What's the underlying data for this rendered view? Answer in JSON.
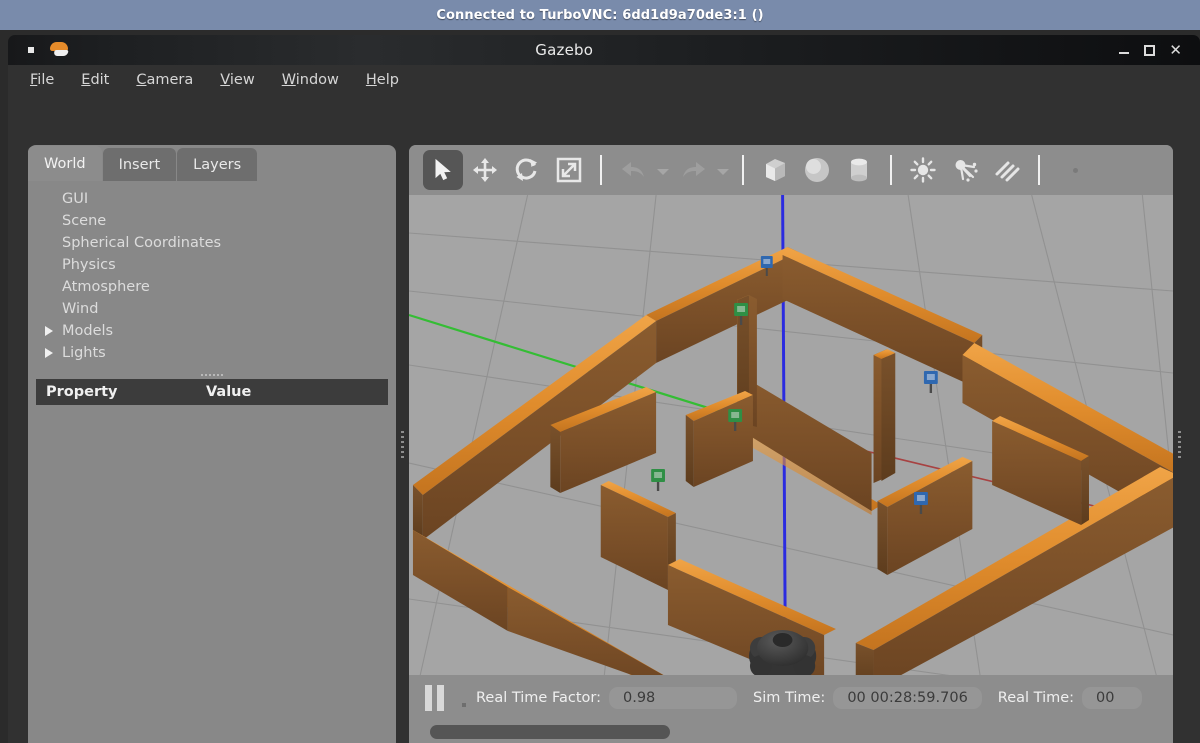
{
  "vnc": {
    "title": "Connected to TurboVNC: 6dd1d9a70de3:1 ()",
    "bar_color": "#798bab"
  },
  "window": {
    "title": "Gazebo",
    "logo_icon": "gazebo-logo-icon",
    "minimize_icon": "minimize-icon",
    "maximize_icon": "maximize-icon",
    "close_icon": "close-icon",
    "close_label": "✕"
  },
  "menubar": {
    "items": [
      {
        "label": "File",
        "mnemonic": "F"
      },
      {
        "label": "Edit",
        "mnemonic": "E"
      },
      {
        "label": "Camera",
        "mnemonic": "C"
      },
      {
        "label": "View",
        "mnemonic": "V"
      },
      {
        "label": "Window",
        "mnemonic": "W"
      },
      {
        "label": "Help",
        "mnemonic": "H"
      }
    ]
  },
  "left_panel": {
    "tabs": [
      {
        "label": "World",
        "active": true
      },
      {
        "label": "Insert",
        "active": false
      },
      {
        "label": "Layers",
        "active": false
      }
    ],
    "tree": [
      {
        "label": "GUI",
        "expandable": false
      },
      {
        "label": "Scene",
        "expandable": false
      },
      {
        "label": "Spherical Coordinates",
        "expandable": false
      },
      {
        "label": "Physics",
        "expandable": false
      },
      {
        "label": "Atmosphere",
        "expandable": false
      },
      {
        "label": "Wind",
        "expandable": false
      },
      {
        "label": "Models",
        "expandable": true
      },
      {
        "label": "Lights",
        "expandable": true
      }
    ],
    "property_table": {
      "columns": [
        "Property",
        "Value"
      ],
      "rows": []
    }
  },
  "toolbar": {
    "tools": [
      {
        "name": "select-tool",
        "icon": "cursor-arrow-icon",
        "active": true,
        "enabled": true
      },
      {
        "name": "translate-tool",
        "icon": "move-arrows-icon",
        "active": false,
        "enabled": true
      },
      {
        "name": "rotate-tool",
        "icon": "rotate-icon",
        "active": false,
        "enabled": true
      },
      {
        "name": "scale-tool",
        "icon": "scale-icon",
        "active": false,
        "enabled": true
      },
      {
        "name": "undo-tool",
        "icon": "undo-arrow-icon",
        "active": false,
        "enabled": false
      },
      {
        "name": "redo-tool",
        "icon": "redo-arrow-icon",
        "active": false,
        "enabled": false
      },
      {
        "name": "box-tool",
        "icon": "box-icon",
        "active": false,
        "enabled": true
      },
      {
        "name": "sphere-tool",
        "icon": "sphere-icon",
        "active": false,
        "enabled": true
      },
      {
        "name": "cylinder-tool",
        "icon": "cylinder-icon",
        "active": false,
        "enabled": true
      },
      {
        "name": "point-light-tool",
        "icon": "point-light-icon",
        "active": false,
        "enabled": true
      },
      {
        "name": "spot-light-tool",
        "icon": "spot-light-icon",
        "active": false,
        "enabled": true
      },
      {
        "name": "dir-light-tool",
        "icon": "directional-light-icon",
        "active": false,
        "enabled": true
      }
    ]
  },
  "status": {
    "play_state": "paused",
    "pause_icon": "pause-icon",
    "real_time_factor_label": "Real Time Factor:",
    "real_time_factor_value": "0.98",
    "sim_time_label": "Sim Time:",
    "sim_time_value": "00 00:28:59.706",
    "real_time_label": "Real Time:",
    "real_time_value": "00"
  },
  "scene": {
    "description": "Gazebo 3D viewport showing a wooden maze world on a tiled gray ground plane with a dark mobile robot at the origin and small green and blue marker models distributed between the inner walls.",
    "ground_color": "#a4a4a4",
    "wall_color": "#8a5a2b",
    "wall_highlight_color": "#e8962f",
    "axis_colors": {
      "x": "#b03a3a",
      "y": "#2fbf2f",
      "z": "#2b2be0"
    },
    "robot": {
      "name": "mobile-robot",
      "color": "#3b3b3b"
    },
    "markers": [
      {
        "type": "green-marker",
        "color": "#2f8f45"
      },
      {
        "type": "green-marker",
        "color": "#2f8f45"
      },
      {
        "type": "green-marker",
        "color": "#2f8f45"
      },
      {
        "type": "blue-marker",
        "color": "#2f68b0"
      },
      {
        "type": "blue-marker",
        "color": "#2f68b0"
      },
      {
        "type": "blue-marker",
        "color": "#2f68b0"
      }
    ]
  }
}
